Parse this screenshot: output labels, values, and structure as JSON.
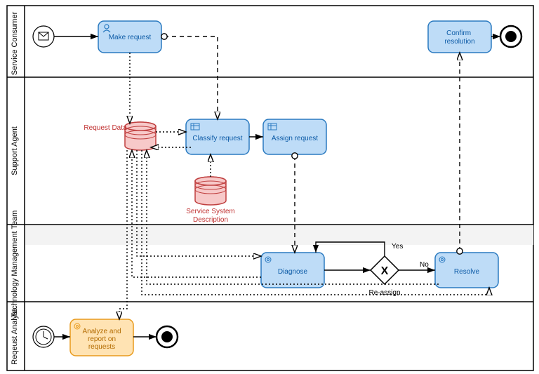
{
  "lanes": {
    "l1": "Service Consumer",
    "l2": "Support Agent",
    "l3": "Technology Management Team",
    "l4": "Reqeust Analyst"
  },
  "tasks": {
    "make_request": "Make request",
    "confirm_resolution": "Confirm resolution",
    "classify_request": "Classify request",
    "assign_request": "Assign request",
    "diagnose": "Diagnose",
    "resolve": "Resolve",
    "analyze_line1": "Analyze and",
    "analyze_line2": "report on",
    "analyze_line3": "requests"
  },
  "datastores": {
    "request_data": "Request Data",
    "service_system_line1": "Service System",
    "service_system_line2": "Description"
  },
  "gateway": {
    "yes": "Yes",
    "no": "No",
    "reassign": "Re-assign"
  }
}
